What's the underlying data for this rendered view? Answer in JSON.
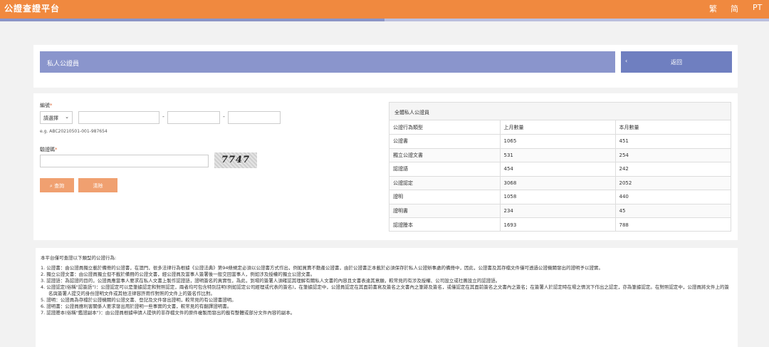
{
  "header": {
    "title": "公證查證平台",
    "lang_traditional": "繁",
    "lang_simplified": "简",
    "lang_pt": "PT"
  },
  "banner": {
    "title": "私人公證員",
    "back_label": "返回"
  },
  "form": {
    "doc_no_label": "編號",
    "required_mark": "*",
    "select_value": "請選擇",
    "dash": "-",
    "hint": "e.g. ABC20210501-001-987654",
    "captcha_label": "驗證碼",
    "captcha_text": "7747",
    "search_label": "查詢",
    "clear_label": "清除"
  },
  "stats": {
    "title": "全體私人公證員",
    "columns": [
      "公證行為類型",
      "上月數量",
      "本月數量"
    ],
    "rows": [
      [
        "公證書",
        "1065",
        "451"
      ],
      [
        "獨立公證文書",
        "531",
        "254"
      ],
      [
        "認證語",
        "454",
        "242"
      ],
      [
        "公證認定",
        "3068",
        "2052"
      ],
      [
        "證明",
        "1058",
        "440"
      ],
      [
        "證明書",
        "234",
        "45"
      ],
      [
        "認證謄本",
        "1693",
        "788"
      ]
    ]
  },
  "notes": {
    "intro": "本平台僅可查證以下類型的公證行為:",
    "items": [
      "1. 公證書：由公證員獨立載於備冊的公證書，在澳門，很多法律行為根據《公證法典》第94條規定必須以公證書方式作出，例如買賣不動產公證書，由於公證書正本載於必須保存於私人公證辦事處的備冊中，因此，公證書及其存檔文件僅可透過公證機關發出的證明予以證實。",
      "2. 獨立公證文書：由公證員獨立但不載於備冊的公證文書，經公證員及當事人簽署後一般交回當事人，例如涉及授權的獨立公證文書。",
      "3. 認證語：為認證的目的，公證員應當事人要求在私人文書上製作認證語，證明簽名的真實性，為此，到場的簽署人須確認其理解有關私人文書的內容且文書表達其意願，較常見的有涉及授權、公司設立或社團設立的認證語。",
      "4. 公證認定(俗稱\"認簽語\")：公證認定可以是筆據認定和對照認定，兩者均可包含特別註明(例如認定公司經理或代表的簽名)，在筆據認定中，公證員認定在其面前書寫及簽名之文書內之筆跡及簽名，或僅認定在其面前簽名之文書內之簽名；在簽署人於認定時在場之情況下作出之認定，亦為筆據認定。在對照認定中，公證員將文件上的簽名與簽署人提交的身份證明文件或其他法律容許用作對照的文件上的簽名作比對。",
      "5. 證明：公證員為存檔於公證機關的公證文書、登記及文件發出證明，較常見的有公證書證明。",
      "6. 證明書：公證員應利害關係人要求發出用於證明一些事實的文書，較常見的有翻譯證明書。",
      "7. 認證謄本(俗稱\"鑑證副本\")：由公證員根據申請人提供的非存檔文件的原件複製而發出的載有整體或部分文件內容的副本。"
    ]
  }
}
